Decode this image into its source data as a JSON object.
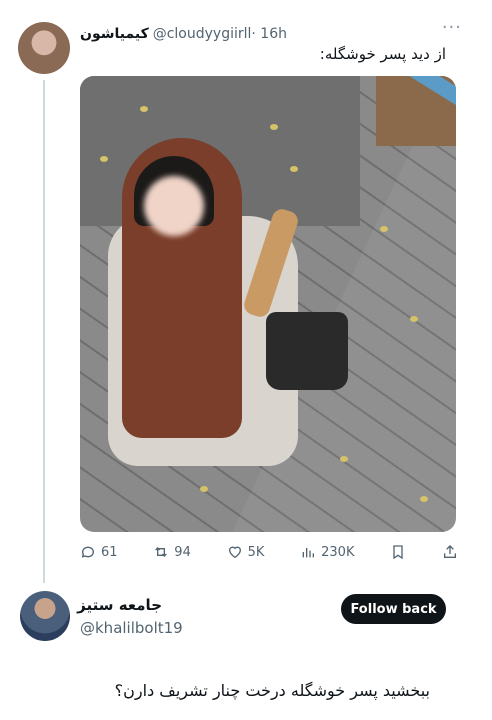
{
  "tweet": {
    "author_name": "کیمیاشون",
    "handle": "@cloudyygiirll",
    "time": "· 16h",
    "more": "···",
    "text": "از دید پسر خوشگله:"
  },
  "actions": {
    "replies": "61",
    "retweets": "94",
    "likes": "5K",
    "views": "230K"
  },
  "reply": {
    "author_name": "جامعه ستیز",
    "handle": "@khalilbolt19",
    "follow_label": "Follow back",
    "text": "ببخشید پسر خوشگله درخت چنار تشریف دارن؟"
  },
  "colors": {
    "text": "#0f1419",
    "muted": "#536471",
    "line": "#cfd9de",
    "button": "#0f1419"
  }
}
